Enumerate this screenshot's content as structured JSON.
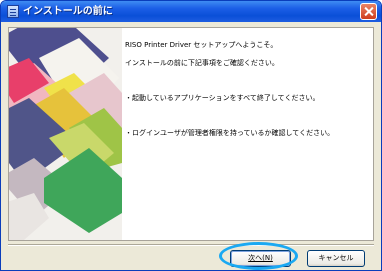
{
  "window": {
    "title": "インストールの前に"
  },
  "welcome": {
    "line1": "RISO Printer Driver セットアップへようこそ。",
    "line2": "インストールの前に下記事項をご確認ください。"
  },
  "notes": [
    "・起動しているアプリケーションをすべて終了してください。",
    "・ログインユーザが管理者権限を持っているか確認してください。"
  ],
  "buttons": {
    "next": "次へ(N)",
    "cancel": "キャンセル"
  },
  "colors": {
    "title_bar": "#0a4fd8",
    "highlight": "#1aa9f2",
    "close": "#cf3e1e"
  },
  "icons": {
    "window": "installer-icon",
    "close": "close-icon"
  }
}
